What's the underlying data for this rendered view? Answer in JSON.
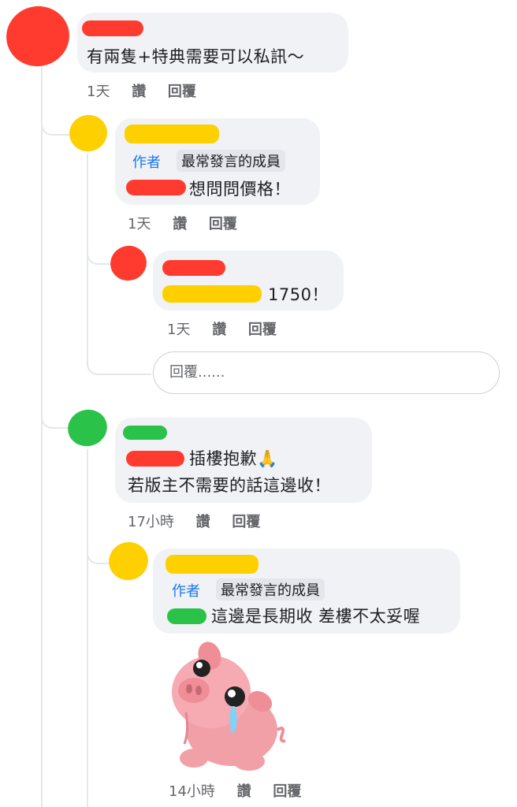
{
  "comments": [
    {
      "text": "有兩隻+特典需要可以私訊～",
      "meta": {
        "time": "1天",
        "like": "讚",
        "reply": "回覆"
      }
    },
    {
      "author_label": "作者",
      "role_badge": "最常發言的成員",
      "text": "想問問價格！",
      "meta": {
        "time": "1天",
        "like": "讚",
        "reply": "回覆"
      }
    },
    {
      "text": "1750！",
      "meta": {
        "time": "1天",
        "like": "讚",
        "reply": "回覆"
      }
    },
    {
      "reply_placeholder": "回覆......"
    },
    {
      "text_line1": "插樓抱歉🙏",
      "text_line2": "若版主不需要的話這邊收！",
      "meta": {
        "time": "17小時",
        "like": "讚",
        "reply": "回覆"
      }
    },
    {
      "author_label": "作者",
      "role_badge": "最常發言的成員",
      "text": "這邊是長期收 差樓不太妥喔",
      "sticker": "crying-pig-sticker",
      "meta": {
        "time": "14小時",
        "like": "讚",
        "reply": "回覆"
      }
    }
  ],
  "colors": {
    "author_blue": "#1877f2",
    "bubble_bg": "#f0f2f5",
    "redact_red": "#ff3b2f",
    "redact_yellow": "#ffd000",
    "redact_green": "#2bc24a"
  }
}
